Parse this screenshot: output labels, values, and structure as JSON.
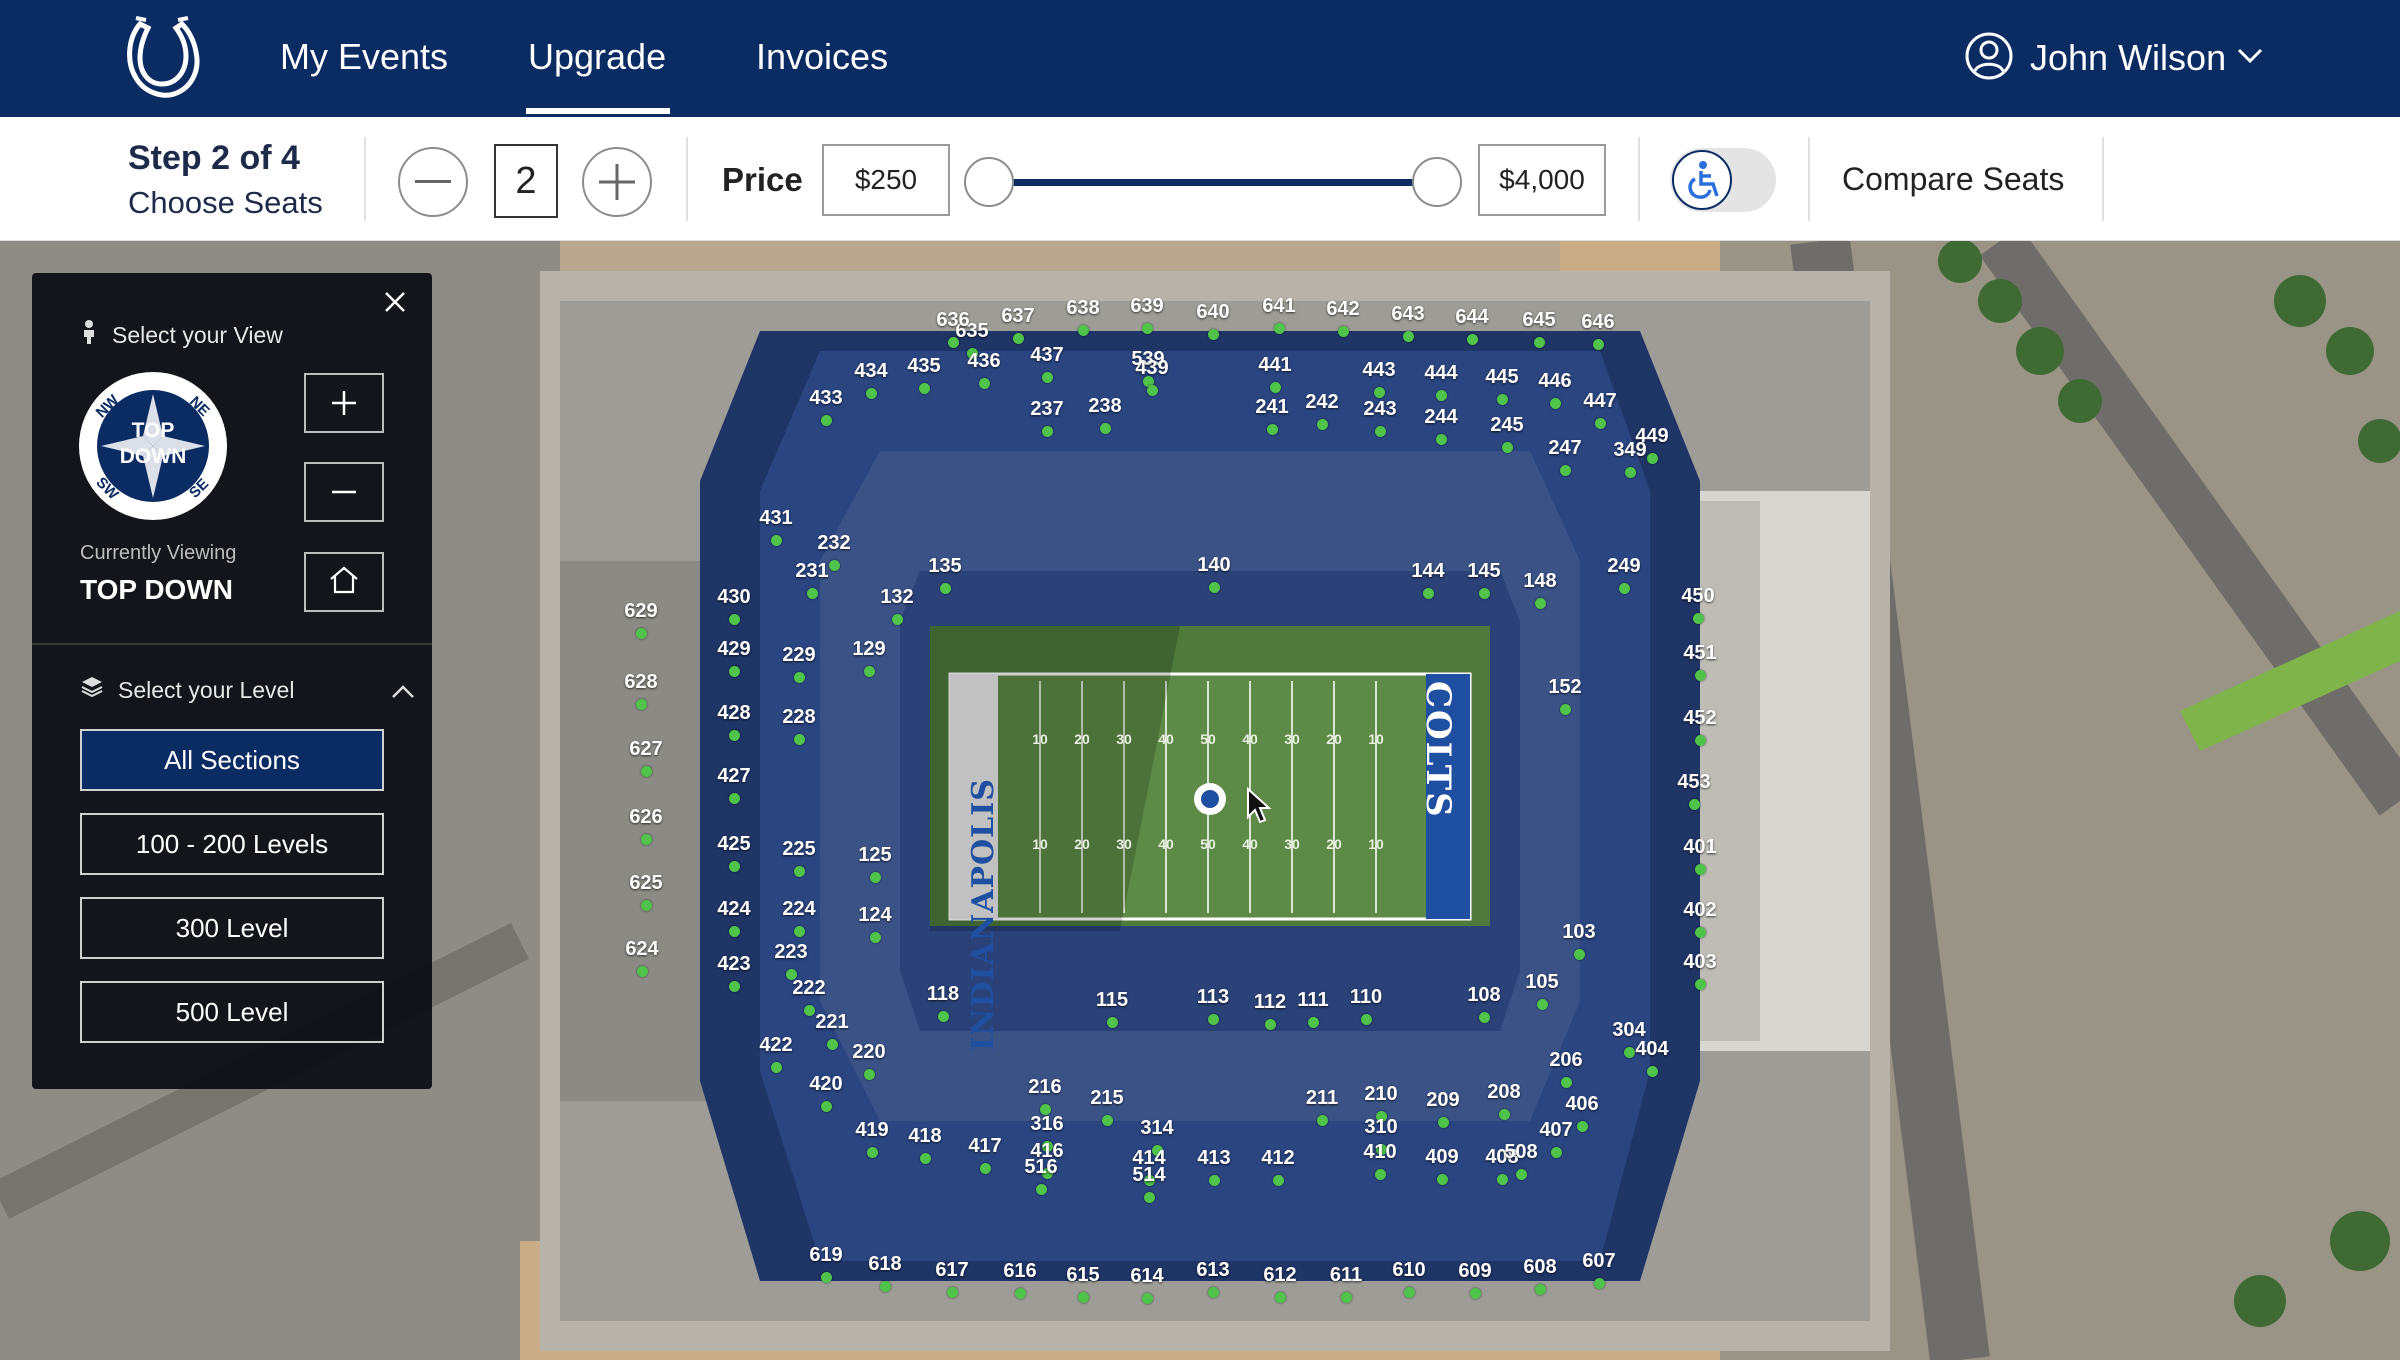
{
  "nav": {
    "items": [
      {
        "label": "My Events",
        "active": false
      },
      {
        "label": "Upgrade",
        "active": true
      },
      {
        "label": "Invoices",
        "active": false
      }
    ],
    "user_name": "John Wilson"
  },
  "toolbar": {
    "step_title": "Step 2 of 4",
    "step_subtitle": "Choose Seats",
    "quantity": "2",
    "price_label": "Price",
    "price_min": "$250",
    "price_max": "$4,000",
    "accessibility_toggle": false,
    "compare_label": "Compare Seats"
  },
  "panel": {
    "view_title": "Select your View",
    "compass_text_line1": "TOP",
    "compass_text_line2": "DOWN",
    "compass_dirs": {
      "nw": "NW",
      "ne": "NE",
      "sw": "SW",
      "se": "SE"
    },
    "currently_viewing_label": "Currently Viewing",
    "currently_viewing_value": "TOP DOWN",
    "level_title": "Select your Level",
    "levels": [
      {
        "label": "All Sections",
        "selected": true
      },
      {
        "label": "100 - 200 Levels",
        "selected": false
      },
      {
        "label": "300 Level",
        "selected": false
      },
      {
        "label": "500 Level",
        "selected": false
      }
    ]
  },
  "field": {
    "left_endzone": "INDIANAPOLIS",
    "right_endzone": "COLTS",
    "yard_numbers": [
      "10",
      "20",
      "30",
      "40",
      "50",
      "40",
      "30",
      "20",
      "10"
    ]
  },
  "colors": {
    "brand_navy": "#0b2b63",
    "available_dot": "#4fc34a",
    "field_green": "#4f7a3c"
  },
  "sections": [
    "635",
    "636",
    "637",
    "638",
    "639",
    "640",
    "641",
    "642",
    "643",
    "644",
    "645",
    "646",
    "539",
    "434",
    "435",
    "436",
    "437",
    "439",
    "441",
    "443",
    "444",
    "445",
    "446",
    "433",
    "237",
    "238",
    "241",
    "242",
    "243",
    "244",
    "245",
    "447",
    "431",
    "247",
    "449",
    "349",
    "232",
    "231",
    "135",
    "140",
    "144",
    "145",
    "148",
    "249",
    "450",
    "629",
    "430",
    "132",
    "429",
    "229",
    "129",
    "451",
    "628",
    "428",
    "228",
    "152",
    "452",
    "627",
    "427",
    "453",
    "626",
    "425",
    "225",
    "125",
    "401",
    "625",
    "424",
    "224",
    "124",
    "402",
    "223",
    "103",
    "624",
    "423",
    "403",
    "222",
    "118",
    "115",
    "113",
    "112",
    "111",
    "110",
    "108",
    "105",
    "221",
    "304",
    "422",
    "220",
    "404",
    "206",
    "420",
    "216",
    "215",
    "211",
    "210",
    "209",
    "208",
    "406",
    "419",
    "418",
    "417",
    "316",
    "416",
    "314",
    "414",
    "413",
    "412",
    "310",
    "410",
    "409",
    "408",
    "407",
    "508",
    "516",
    "514",
    "619",
    "618",
    "617",
    "616",
    "615",
    "614",
    "613",
    "612",
    "611",
    "610",
    "609",
    "608",
    "607"
  ],
  "icons": {
    "logo": "horseshoe-logo",
    "user": "user-icon",
    "accessibility": "wheelchair-icon",
    "compass": "compass-icon",
    "home": "home-icon",
    "layers": "layers-icon"
  }
}
